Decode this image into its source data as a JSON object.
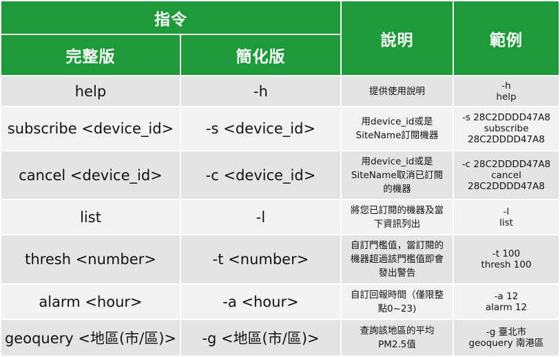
{
  "header": {
    "command": "指令",
    "full": "完整版",
    "short": "簡化版",
    "desc": "說明",
    "example": "範例"
  },
  "rows": [
    {
      "full": "help",
      "short": "-h",
      "desc": [
        "提供使用說明"
      ],
      "example": [
        "-h",
        "help"
      ]
    },
    {
      "full": "subscribe <device_id>",
      "short": "-s <device_id>",
      "desc": [
        "用device_id或是",
        "SiteName訂閱機器"
      ],
      "example": [
        "-s 28C2DDDD47A8",
        "subscribe",
        "28C2DDDD47A8"
      ]
    },
    {
      "full": "cancel <device_id>",
      "short": "-c <device_id>",
      "desc": [
        "用device_id或是",
        "SiteName取消已訂閱",
        "的機器"
      ],
      "example": [
        "-c 28C2DDDD47A8",
        "cancel",
        "28C2DDDD47A8"
      ]
    },
    {
      "full": "list",
      "short": "-l",
      "desc": [
        "將您已訂閱的機器及當",
        "下資訊列出"
      ],
      "example": [
        "-l",
        "list"
      ]
    },
    {
      "full": "thresh <number>",
      "short": "-t <number>",
      "desc": [
        "自訂門檻值，當訂閱的",
        "機器超過該門檻值即會",
        "發出警告"
      ],
      "example": [
        "-t 100",
        "thresh 100"
      ]
    },
    {
      "full": "alarm <hour>",
      "short": "-a <hour>",
      "desc": [
        "自訂回報時間（僅限整",
        "點0~23)"
      ],
      "example": [
        "-a 12",
        "alarm 12"
      ]
    },
    {
      "full": "geoquery <地區(市/區)>",
      "short": "-g <地區(市/區)>",
      "desc": [
        "查詢該地區的平均",
        "PM2.5值"
      ],
      "example": [
        "-g 臺北市",
        "geoquery 南港區"
      ]
    }
  ]
}
